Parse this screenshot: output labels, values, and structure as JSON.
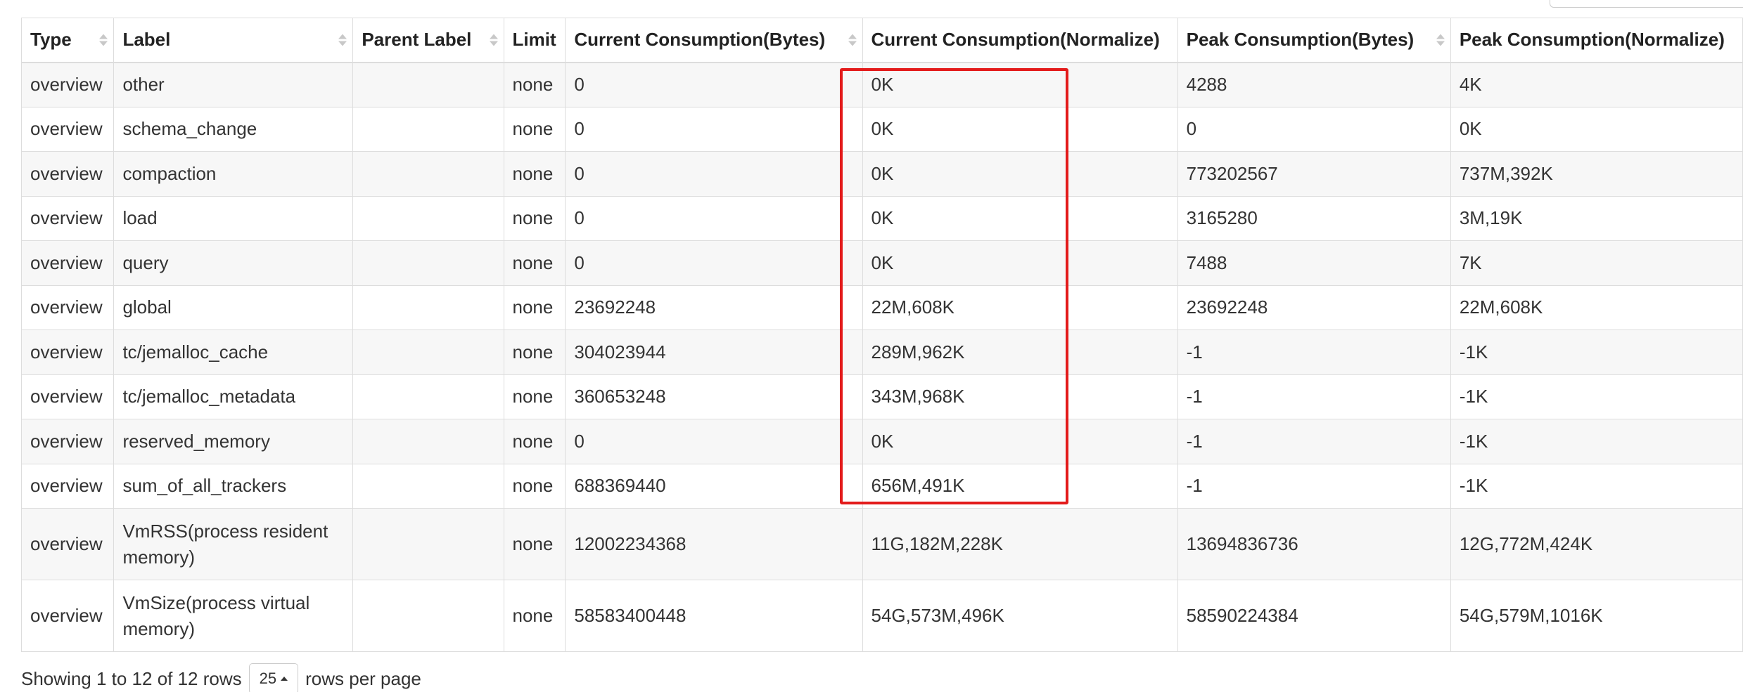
{
  "table": {
    "columns": [
      {
        "label": "Type"
      },
      {
        "label": "Label"
      },
      {
        "label": "Parent Label"
      },
      {
        "label": "Limit"
      },
      {
        "label": "Current Consumption(Bytes)"
      },
      {
        "label": "Current Consumption(Normalize)"
      },
      {
        "label": "Peak Consumption(Bytes)"
      },
      {
        "label": "Peak Consumption(Normalize)"
      }
    ],
    "rows": [
      {
        "type": "overview",
        "label": "other",
        "parent": "",
        "limit": "none",
        "cur_bytes": "0",
        "cur_norm": "0K",
        "peak_bytes": "4288",
        "peak_norm": "4K"
      },
      {
        "type": "overview",
        "label": "schema_change",
        "parent": "",
        "limit": "none",
        "cur_bytes": "0",
        "cur_norm": "0K",
        "peak_bytes": "0",
        "peak_norm": "0K"
      },
      {
        "type": "overview",
        "label": "compaction",
        "parent": "",
        "limit": "none",
        "cur_bytes": "0",
        "cur_norm": "0K",
        "peak_bytes": "773202567",
        "peak_norm": "737M,392K"
      },
      {
        "type": "overview",
        "label": "load",
        "parent": "",
        "limit": "none",
        "cur_bytes": "0",
        "cur_norm": "0K",
        "peak_bytes": "3165280",
        "peak_norm": "3M,19K"
      },
      {
        "type": "overview",
        "label": "query",
        "parent": "",
        "limit": "none",
        "cur_bytes": "0",
        "cur_norm": "0K",
        "peak_bytes": "7488",
        "peak_norm": "7K"
      },
      {
        "type": "overview",
        "label": "global",
        "parent": "",
        "limit": "none",
        "cur_bytes": "23692248",
        "cur_norm": "22M,608K",
        "peak_bytes": "23692248",
        "peak_norm": "22M,608K"
      },
      {
        "type": "overview",
        "label": "tc/jemalloc_cache",
        "parent": "",
        "limit": "none",
        "cur_bytes": "304023944",
        "cur_norm": "289M,962K",
        "peak_bytes": "-1",
        "peak_norm": "-1K"
      },
      {
        "type": "overview",
        "label": "tc/jemalloc_metadata",
        "parent": "",
        "limit": "none",
        "cur_bytes": "360653248",
        "cur_norm": "343M,968K",
        "peak_bytes": "-1",
        "peak_norm": "-1K"
      },
      {
        "type": "overview",
        "label": "reserved_memory",
        "parent": "",
        "limit": "none",
        "cur_bytes": "0",
        "cur_norm": "0K",
        "peak_bytes": "-1",
        "peak_norm": "-1K"
      },
      {
        "type": "overview",
        "label": "sum_of_all_trackers",
        "parent": "",
        "limit": "none",
        "cur_bytes": "688369440",
        "cur_norm": "656M,491K",
        "peak_bytes": "-1",
        "peak_norm": "-1K"
      },
      {
        "type": "overview",
        "label": "VmRSS(process resident memory)",
        "parent": "",
        "limit": "none",
        "cur_bytes": "12002234368",
        "cur_norm": "11G,182M,228K",
        "peak_bytes": "13694836736",
        "peak_norm": "12G,772M,424K"
      },
      {
        "type": "overview",
        "label": "VmSize(process virtual memory)",
        "parent": "",
        "limit": "none",
        "cur_bytes": "58583400448",
        "cur_norm": "54G,573M,496K",
        "peak_bytes": "58590224384",
        "peak_norm": "54G,579M,1016K"
      }
    ]
  },
  "highlight": {
    "color": "#e31b1b"
  },
  "pagination": {
    "summary": "Showing 1 to 12 of 12 rows",
    "page_size": "25",
    "suffix": "rows per page"
  }
}
